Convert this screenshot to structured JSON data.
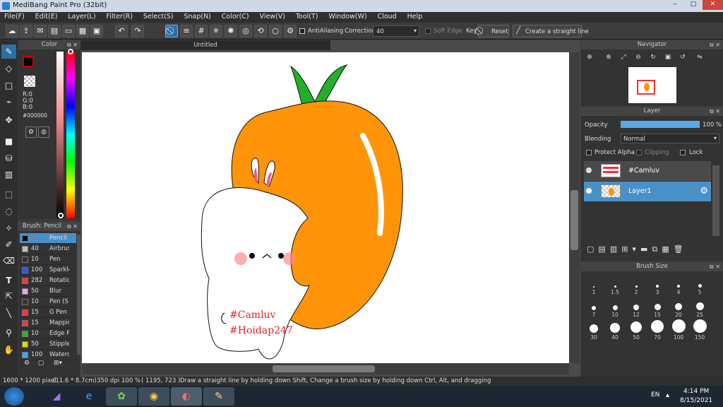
{
  "window": {
    "title": "MediBang Paint Pro (32bit)",
    "controls": [
      "‒",
      "□",
      "✕"
    ]
  },
  "menu": [
    "File(F)",
    "Edit(E)",
    "Layer(L)",
    "Filter(R)",
    "Select(S)",
    "Snap(N)",
    "Color(C)",
    "View(V)",
    "Tool(T)",
    "Window(W)",
    "Cloud",
    "Help"
  ],
  "toolbar": {
    "antialiasing_label": "AntiAliasing",
    "correction_label": "Correction",
    "correction_value": "40",
    "soft_edge_label": "Soft Edge",
    "key_label": "Key",
    "reset_label": "Reset",
    "straight_line_label": "Create a straight line"
  },
  "document": {
    "tab_title": "Untitled",
    "texts": [
      "#Camluv",
      "#Hoidap247"
    ]
  },
  "color_panel": {
    "title": "Color",
    "r": "R:0",
    "g": "G:0",
    "b": "B:0",
    "hex": "#000000",
    "fg": "#000000",
    "accent": "#cc0000"
  },
  "brush_panel": {
    "title": "Brush: Pencil",
    "items": [
      {
        "size": "2",
        "name": "Pencil",
        "color": "#000000",
        "selected": true
      },
      {
        "size": "40",
        "name": "Airbrush",
        "color": "#bdbdbd"
      },
      {
        "size": "10",
        "name": "Pen",
        "color": "#333333"
      },
      {
        "size": "100",
        "name": "Sparkle",
        "color": "#2255ff"
      },
      {
        "size": "282",
        "name": "Rotation",
        "color": "#ff3333"
      },
      {
        "size": "50",
        "name": "Blur",
        "color": "#ff99ff"
      },
      {
        "size": "10",
        "name": "Pen (S",
        "color": "#333333"
      },
      {
        "size": "15",
        "name": "G Pen",
        "color": "#ff3333"
      },
      {
        "size": "15",
        "name": "Mapping",
        "color": "#ff3333"
      },
      {
        "size": "10",
        "name": "Edge Pen",
        "color": "#22bb22"
      },
      {
        "size": "50",
        "name": "Stipple",
        "color": "#dddd00"
      },
      {
        "size": "100",
        "name": "Watercolor",
        "color": "#33aaff"
      }
    ]
  },
  "navigator": {
    "title": "Navigator"
  },
  "layer_panel": {
    "title": "Layer",
    "opacity_label": "Opacity",
    "opacity_value": "100 %",
    "opacity_fraction": 1.0,
    "blending_label": "Blending",
    "blending_value": "Normal",
    "protect_alpha_label": "Protect Alpha",
    "clipping_label": "Clipping",
    "lock_label": "Lock",
    "layers": [
      {
        "name": "#Camluv",
        "selected": false
      },
      {
        "name": "Layer1",
        "selected": true
      }
    ]
  },
  "brush_size_panel": {
    "title": "Brush Size",
    "sizes": [
      "1",
      "1.5",
      "2",
      "3",
      "4",
      "5",
      "7",
      "10",
      "12",
      "15",
      "20",
      "25",
      "30",
      "40",
      "50",
      "70",
      "100",
      "150"
    ]
  },
  "status": {
    "dimensions": "1600 * 1200 pixel",
    "physical": "(11.6 * 8.7cm)",
    "dpi": "350 dpi",
    "zoom": "100 %",
    "coords": "( 1195, 723 )",
    "hint": "Draw a straight line by holding down Shift, Change a brush size by holding down Ctrl, Alt, and dragging"
  },
  "taskbar": {
    "language": "EN",
    "time": "4:14 PM",
    "date": "8/15/2021"
  }
}
